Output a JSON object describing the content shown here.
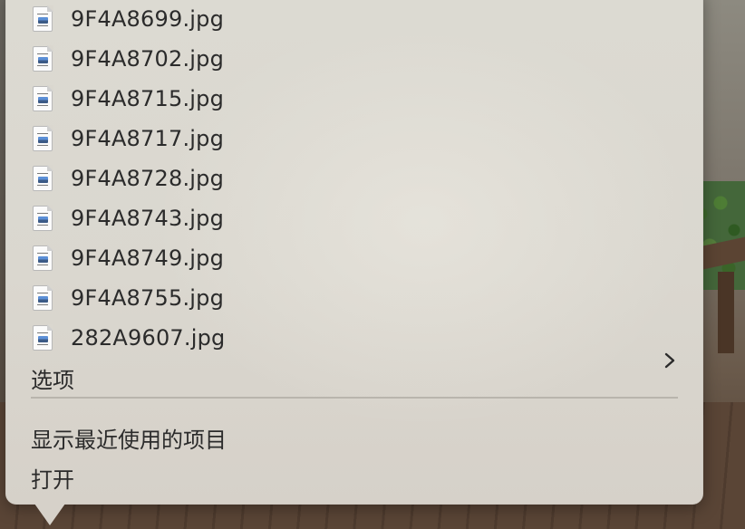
{
  "recent_files": [
    {
      "name": "9F4A8699.jpg",
      "icon": "jpg-file-icon"
    },
    {
      "name": "9F4A8702.jpg",
      "icon": "jpg-file-icon"
    },
    {
      "name": "9F4A8715.jpg",
      "icon": "jpg-file-icon"
    },
    {
      "name": "9F4A8717.jpg",
      "icon": "jpg-file-icon"
    },
    {
      "name": "9F4A8728.jpg",
      "icon": "jpg-file-icon"
    },
    {
      "name": "9F4A8743.jpg",
      "icon": "jpg-file-icon"
    },
    {
      "name": "9F4A8749.jpg",
      "icon": "jpg-file-icon"
    },
    {
      "name": "9F4A8755.jpg",
      "icon": "jpg-file-icon"
    },
    {
      "name": "282A9607.jpg",
      "icon": "jpg-file-icon"
    }
  ],
  "menu": {
    "options_label": "选项",
    "options_icon": "chevron-right-icon",
    "show_recent_label": "显示最近使用的项目",
    "open_label": "打开"
  }
}
